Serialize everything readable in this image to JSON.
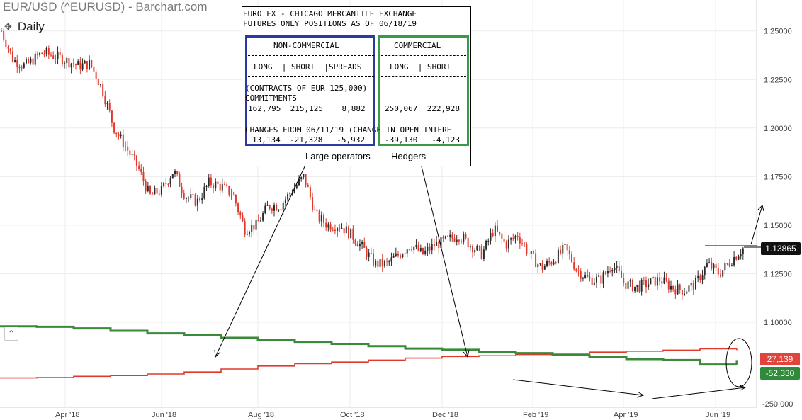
{
  "header": {
    "title": "EUR/USD (^EURUSD) - Barchart.com",
    "period": "Daily"
  },
  "cot_table": {
    "line1": "EURO FX - CHICAGO MERCANTILE EXCHANGE",
    "line2": "FUTURES ONLY POSITIONS AS OF 06/18/19",
    "noncommercial_head": "NON-COMMERCIAL",
    "commercial_head": "COMMERCIAL",
    "nc_cols": "LONG  | SHORT  |SPREADS",
    "cm_cols": "LONG  | SHORT",
    "contracts_line": "(CONTRACTS OF EUR 125,000)",
    "commitments_label": "COMMITMENTS",
    "nc_commitments": "162,795  215,125    8,882",
    "cm_commitments": "250,067  222,928",
    "changes_line": "CHANGES FROM 06/11/19 (CHANGE IN OPEN INTERE",
    "nc_changes": "13,134  -21,328   -5,932",
    "cm_changes": "-39,130   -4,123",
    "label_large": "Large operators",
    "label_hedgers": "Hedgers"
  },
  "badges": {
    "last_price": "1.13865",
    "red_value": "27,139",
    "green_value": "-52,330"
  },
  "colors": {
    "up": "#2a2a2a",
    "down": "#e0392b",
    "green_line": "#3a8a3a",
    "red_line": "#e0392b",
    "nc_frame": "#2b3aa3",
    "cm_frame": "#3a9a4a"
  },
  "chart_data": [
    {
      "type": "candlestick",
      "series_name": "EUR/USD",
      "xlabels": [
        "Apr '18",
        "Jun '18",
        "Aug '18",
        "Oct '18",
        "Dec '18",
        "Feb '19",
        "Apr '19",
        "Jun '19"
      ],
      "yticks": [
        "1.25000",
        "1.22500",
        "1.20000",
        "1.17500",
        "1.15000",
        "1.12500",
        "1.10000"
      ],
      "ytick_values": [
        1.25,
        1.225,
        1.2,
        1.175,
        1.15,
        1.125,
        1.1
      ],
      "ylim": [
        1.1,
        1.255
      ],
      "last": 1.13865,
      "trend_points": [
        [
          0,
          1.25
        ],
        [
          4,
          1.235
        ],
        [
          8,
          1.232
        ],
        [
          14,
          1.239
        ],
        [
          20,
          1.236
        ],
        [
          26,
          1.232
        ],
        [
          30,
          1.233
        ],
        [
          34,
          1.22
        ],
        [
          38,
          1.2
        ],
        [
          42,
          1.19
        ],
        [
          46,
          1.18
        ],
        [
          50,
          1.165
        ],
        [
          54,
          1.168
        ],
        [
          58,
          1.178
        ],
        [
          62,
          1.165
        ],
        [
          66,
          1.162
        ],
        [
          70,
          1.172
        ],
        [
          74,
          1.17
        ],
        [
          78,
          1.166
        ],
        [
          82,
          1.148
        ],
        [
          86,
          1.15
        ],
        [
          90,
          1.16
        ],
        [
          94,
          1.16
        ],
        [
          98,
          1.168
        ],
        [
          102,
          1.175
        ],
        [
          106,
          1.155
        ],
        [
          110,
          1.15
        ],
        [
          114,
          1.15
        ],
        [
          118,
          1.145
        ],
        [
          122,
          1.138
        ],
        [
          126,
          1.13
        ],
        [
          130,
          1.13
        ],
        [
          134,
          1.135
        ],
        [
          138,
          1.14
        ],
        [
          142,
          1.135
        ],
        [
          146,
          1.14
        ],
        [
          150,
          1.142
        ],
        [
          154,
          1.145
        ],
        [
          158,
          1.14
        ],
        [
          162,
          1.135
        ],
        [
          166,
          1.148
        ],
        [
          170,
          1.14
        ],
        [
          174,
          1.145
        ],
        [
          178,
          1.135
        ],
        [
          182,
          1.128
        ],
        [
          186,
          1.132
        ],
        [
          190,
          1.138
        ],
        [
          194,
          1.127
        ],
        [
          198,
          1.122
        ],
        [
          202,
          1.122
        ],
        [
          206,
          1.13
        ],
        [
          210,
          1.12
        ],
        [
          214,
          1.118
        ],
        [
          218,
          1.12
        ],
        [
          222,
          1.122
        ],
        [
          226,
          1.118
        ],
        [
          230,
          1.116
        ],
        [
          234,
          1.12
        ],
        [
          238,
          1.13
        ],
        [
          242,
          1.125
        ],
        [
          246,
          1.132
        ],
        [
          250,
          1.138
        ]
      ],
      "annotation_hline": 1.13865
    },
    {
      "type": "line",
      "series": [
        {
          "name": "",
          "values": [
            -120000,
            -118000,
            -112000,
            -108000,
            -100000,
            -90000,
            -75000,
            -60000,
            -48000,
            -40000,
            -30000,
            -20000,
            -12000,
            -8000,
            -2000,
            0,
            10000,
            15000,
            20000,
            27139
          ]
        },
        {
          "name": "",
          "values": [
            140000,
            138000,
            130000,
            118000,
            105000,
            95000,
            82000,
            72000,
            62000,
            52000,
            40000,
            28000,
            22000,
            12000,
            5000,
            -5000,
            -15000,
            -25000,
            -30000,
            -52330
          ]
        }
      ],
      "ylim": [
        -250000,
        150000
      ],
      "ytick_label": "-250,000",
      "xlabels": [
        "Apr '18",
        "Jun '18",
        "Aug '18",
        "Oct '18",
        "Dec '18",
        "Feb '19",
        "Apr '19",
        "Jun '19"
      ]
    }
  ]
}
